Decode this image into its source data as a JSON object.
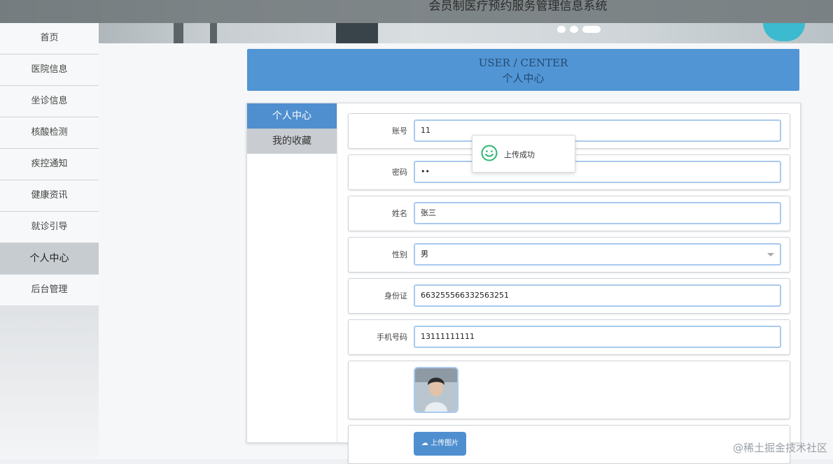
{
  "app": {
    "title": "会员制医疗预约服务管理信息系统"
  },
  "nav": {
    "items": [
      {
        "label": "首页"
      },
      {
        "label": "医院信息"
      },
      {
        "label": "坐诊信息"
      },
      {
        "label": "核酸检测"
      },
      {
        "label": "疾控通知"
      },
      {
        "label": "健康资讯"
      },
      {
        "label": "就诊引导"
      },
      {
        "label": "个人中心",
        "active": true
      },
      {
        "label": "后台管理"
      }
    ]
  },
  "page_header": {
    "en": "USER / CENTER",
    "cn": "个人中心"
  },
  "tabs": [
    {
      "label": "个人中心",
      "active": true
    },
    {
      "label": "我的收藏"
    }
  ],
  "form": {
    "account": {
      "label": "账号",
      "value": "11"
    },
    "password": {
      "label": "密码",
      "value": "••"
    },
    "name": {
      "label": "姓名",
      "value": "张三"
    },
    "gender": {
      "label": "性别",
      "value": "男"
    },
    "id_card": {
      "label": "身份证",
      "value": "663255566332563251"
    },
    "phone": {
      "label": "手机号码",
      "value": "13111111111"
    },
    "upload_label": "上传图片"
  },
  "toast": {
    "message": "上传成功"
  },
  "watermark": "@稀土掘金技术社区",
  "colors": {
    "primary": "#4f8fcf",
    "header": "#5195d4",
    "success": "#2bb673"
  }
}
